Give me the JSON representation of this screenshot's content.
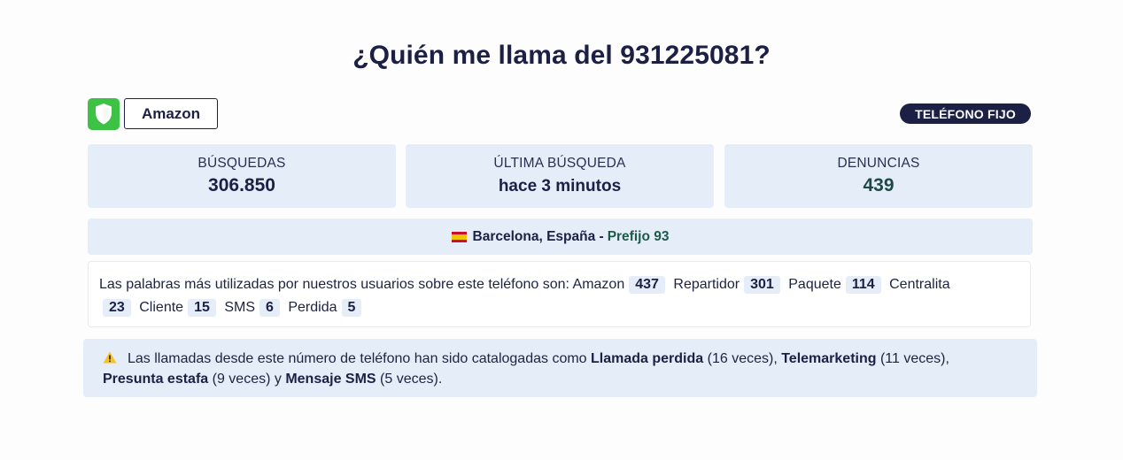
{
  "page_title": "¿Quién me llama del 931225081?",
  "caller": {
    "name": "Amazon",
    "verified_icon": "shield-icon"
  },
  "phone_type": "TELÉFONO FIJO",
  "stats": [
    {
      "label": "BÚSQUEDAS",
      "value": "306.850"
    },
    {
      "label": "ÚLTIMA BÚSQUEDA",
      "value": "hace 3 minutos"
    },
    {
      "label": "DENUNCIAS",
      "value": "439"
    }
  ],
  "location": {
    "text": "Barcelona, España -",
    "prefix": "Prefijo 93",
    "flag_icon": "spain-flag-icon"
  },
  "keywords": {
    "intro": "Las palabras más utilizadas por nuestros usuarios sobre este teléfono son:",
    "items": [
      {
        "word": "Amazon",
        "count": "437"
      },
      {
        "word": "Repartidor",
        "count": "301"
      },
      {
        "word": "Paquete",
        "count": "114"
      },
      {
        "word": "Centralita",
        "count": "23"
      },
      {
        "word": "Cliente",
        "count": "15"
      },
      {
        "word": "SMS",
        "count": "6"
      },
      {
        "word": "Perdida",
        "count": "5"
      }
    ]
  },
  "alert": {
    "icon": "warning-icon",
    "t1": "Las llamadas desde este número de teléfono han sido catalogadas como",
    "c1": "Llamada perdida",
    "n1": "(16 veces),",
    "c2": "Telemarketing",
    "n2": "(11 veces),",
    "c3": "Presunta estafa",
    "n3": "(9 veces) y",
    "c4": "Mensaje SMS",
    "n4": "(5 veces)."
  },
  "colors": {
    "accent": "#1c2044",
    "panel": "#e5edf9",
    "shield": "#3dc246",
    "denuncias": "#1e4a46"
  }
}
